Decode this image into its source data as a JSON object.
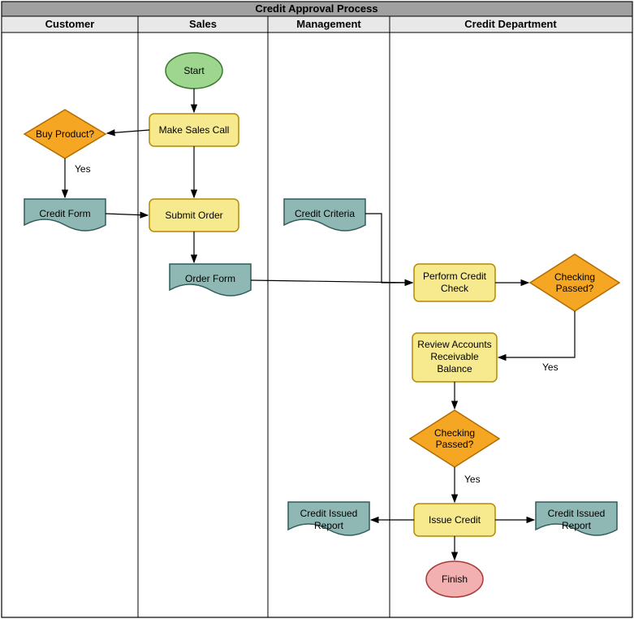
{
  "title": "Credit Approval Process",
  "lanes": {
    "customer": "Customer",
    "sales": "Sales",
    "management": "Management",
    "credit": "Credit Department"
  },
  "nodes": {
    "start": "Start",
    "make_sales_call": "Make Sales Call",
    "buy_product": "Buy Product?",
    "credit_form": "Credit Form",
    "submit_order": "Submit Order",
    "order_form": "Order Form",
    "credit_criteria": "Credit Criteria",
    "perform_credit_check_l1": "Perform Credit",
    "perform_credit_check_l2": "Check",
    "checking_passed1_l1": "Checking",
    "checking_passed1_l2": "Passed?",
    "review_ar_l1": "Review Accounts",
    "review_ar_l2": "Receivable",
    "review_ar_l3": "Balance",
    "checking_passed2_l1": "Checking",
    "checking_passed2_l2": "Passed?",
    "issue_credit": "Issue Credit",
    "credit_issued_report_l1": "Credit Issued",
    "credit_issued_report_l2": "Report",
    "finish": "Finish"
  },
  "edges": {
    "yes": "Yes"
  },
  "colors": {
    "header_bg": "#a0a0a0",
    "lane_header_bg": "#e8e8e8",
    "border": "#000000",
    "process_fill": "#f7e98e",
    "process_stroke": "#b38b00",
    "decision_fill": "#f5a623",
    "decision_stroke": "#b36b00",
    "document_fill": "#8fb7b3",
    "document_stroke": "#2f5d5a",
    "start_fill": "#9fd68f",
    "start_stroke": "#3a7a2c",
    "finish_fill": "#f2b0b0",
    "finish_stroke": "#a83a3a",
    "arrow": "#000000"
  }
}
